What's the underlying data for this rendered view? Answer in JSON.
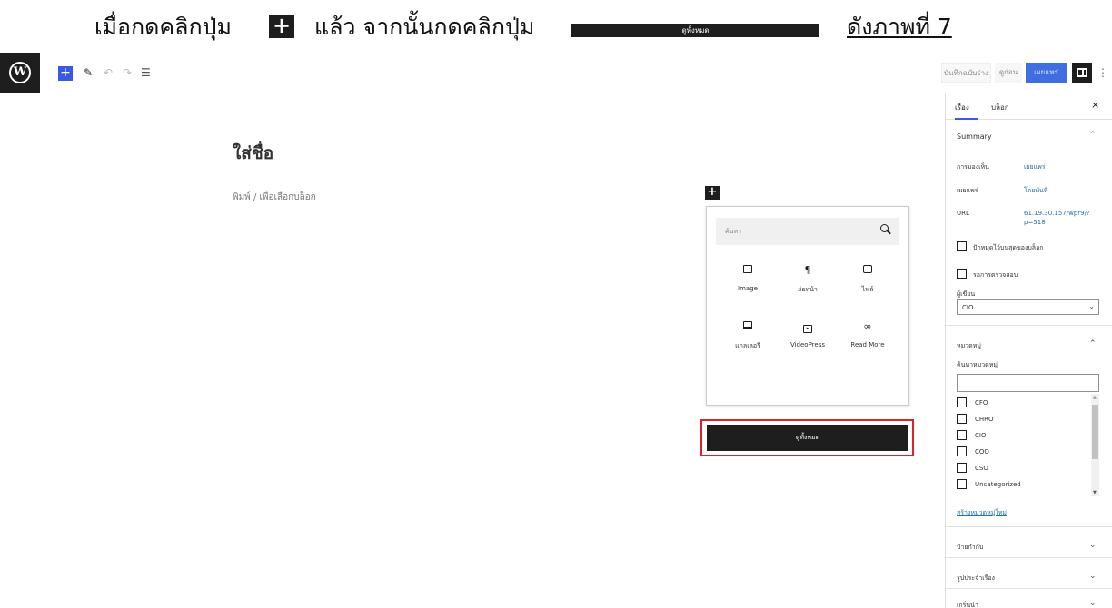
{
  "caption": {
    "part1": "เมื่อกดคลิกปุ่ม",
    "plus_icon": "plus-icon",
    "part2": "แล้ว จากนั้นกดคลิกปุ่ม",
    "button_text": "ดูทั้งหมด",
    "part3": "ดังภาพที่ 7"
  },
  "toolbar": {
    "logo": "W",
    "add_icon": "+",
    "pen_icon": "✎",
    "undo_icon": "↶",
    "redo_icon": "↷",
    "list_icon": "☰",
    "save_draft": "บันทึกฉบับร่าง",
    "preview": "ดูก่อน",
    "publish": "เผยแพร่",
    "more": "⋮"
  },
  "canvas": {
    "title_placeholder": "ใส่ชื่อ",
    "body_hint": "พิมพ์ / เพื่อเลือกบล็อก"
  },
  "inserter": {
    "toggle": "+",
    "search_placeholder": "ค้นหา",
    "blocks": [
      {
        "icon": "image-icon",
        "label": "Image"
      },
      {
        "icon": "paragraph-icon",
        "label": "ย่อหน้า"
      },
      {
        "icon": "file-icon",
        "label": "ไฟล์"
      },
      {
        "icon": "gallery-icon",
        "label": "แกลเลอรี"
      },
      {
        "icon": "videopress-icon",
        "label": "VideoPress"
      },
      {
        "icon": "link-icon",
        "label": "Read More"
      }
    ],
    "view_all": "ดูทั้งหมด"
  },
  "sidebar": {
    "tab_post": "เรื่อง",
    "tab_block": "บล็อก",
    "close": "×",
    "summary": {
      "title": "Summary",
      "visibility_label": "การมองเห็น",
      "visibility_value": "เผยแพร่",
      "publish_label": "เผยแพร่",
      "publish_value": "โดยทันที",
      "url_label": "URL",
      "url_line1": "61.19.30.157/wpr9/?",
      "url_line2": "p=518",
      "stick_label": "ปักหมุดไว้บนสุดของบล็อก",
      "pending_label": "รอการตรวจสอบ",
      "author_label": "ผู้เขียน",
      "author_value": "CIO"
    },
    "categories": {
      "title": "หมวดหมู่",
      "search_label": "ค้นหาหมวดหมู่",
      "items": [
        "CFO",
        "CHRO",
        "CIO",
        "COO",
        "CSO",
        "Uncategorized"
      ],
      "add_new": "สร้างหมวดหมู่ใหม่"
    },
    "tags": "ป้ายกำกับ",
    "featured_image": "รูปประจำเรื่อง",
    "excerpt": "เกริ่นนำ"
  }
}
